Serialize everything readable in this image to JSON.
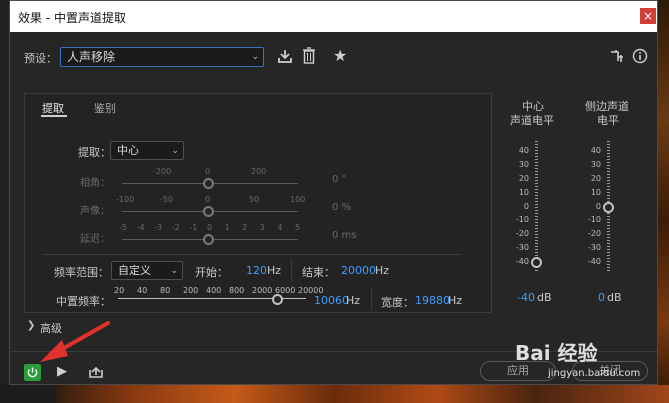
{
  "window": {
    "title": "效果 - 中置声道提取",
    "close": "×"
  },
  "preset": {
    "label": "预设：",
    "value": "人声移除"
  },
  "icons": {
    "download": "download-icon",
    "delete": "trash-icon",
    "favorite": "star-icon",
    "route": "routing-icon",
    "info": "info-icon"
  },
  "tabs": [
    "提取",
    "鉴别"
  ],
  "extract": {
    "label": "提取：",
    "value": "中心"
  },
  "phase": {
    "label": "相角：",
    "scale": [
      "-200",
      "0",
      "200"
    ],
    "value": "0 °"
  },
  "pan": {
    "label": "声像：",
    "scale": [
      "-100",
      "-50",
      "0",
      "50",
      "100"
    ],
    "value": "0 %"
  },
  "delay": {
    "label": "延迟：",
    "scale": [
      "-5",
      "-4",
      "-3",
      "-2",
      "-1",
      "0",
      "1",
      "2",
      "3",
      "4",
      "5"
    ],
    "value": "0 ms"
  },
  "freq_range": {
    "label": "频率范围：",
    "value": "自定义",
    "start_label": "开始：",
    "start_value": "120",
    "start_unit": "Hz",
    "end_label": "结束：",
    "end_value": "20000",
    "end_unit": "Hz"
  },
  "center_freq": {
    "label": "中置频率：",
    "scale": [
      "20",
      "40",
      "80",
      "200",
      "400",
      "800",
      "2000",
      "6000",
      "20000"
    ],
    "value": "10060",
    "unit": "Hz",
    "width_label": "宽度：",
    "width_value": "19880",
    "width_unit": "Hz"
  },
  "meters": {
    "center": {
      "title1": "中心",
      "title2": "声道电平",
      "value": "-40",
      "unit": "dB",
      "level_fraction": 0.0
    },
    "side": {
      "title1": "侧边声道",
      "title2": "电平",
      "value": "0",
      "unit": "dB",
      "level_fraction": 1.0
    },
    "ticks": [
      "40",
      "30",
      "20",
      "10",
      "0",
      "-10",
      "-20",
      "-30",
      "-40"
    ]
  },
  "advanced": {
    "label": "高级"
  },
  "footer": {
    "apply": "应用",
    "close": "关闭"
  },
  "watermark": {
    "brand": "Bai 经验",
    "url": "jingyan.baidu.com"
  },
  "colors": {
    "accent": "#3f9dff",
    "power": "#2a9d3a",
    "arrow": "#e0312b"
  }
}
